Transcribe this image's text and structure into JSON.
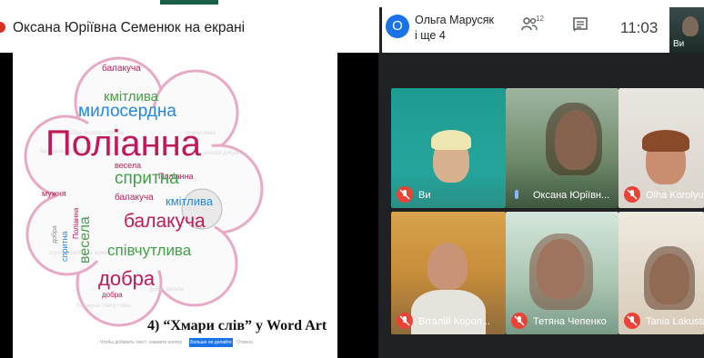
{
  "presentation": {
    "title": "Оксана Юріївна Семенюк на екрані",
    "slide": {
      "caption": "4) “Хмари слів” у Word Art",
      "footer_left": "Чтобы добавить текст, нажмите кнопку",
      "footer_button": "Больше не делайте",
      "footer_right": "Отмена",
      "words": [
        {
          "text": "Поліанна",
          "id": "w1"
        },
        {
          "text": "кмітлива",
          "id": "w2"
        },
        {
          "text": "милосердна",
          "id": "w3"
        },
        {
          "text": "балакуча",
          "id": "w4"
        },
        {
          "text": "спритна",
          "id": "w5"
        },
        {
          "text": "весела",
          "id": "w6"
        },
        {
          "text": "Поліанна",
          "id": "w7"
        },
        {
          "text": "мужня",
          "id": "w8"
        },
        {
          "text": "кмітлива",
          "id": "w9"
        },
        {
          "text": "балакуча",
          "id": "w10"
        },
        {
          "text": "весела",
          "id": "w11"
        },
        {
          "text": "співчутлива",
          "id": "w12"
        },
        {
          "text": "добра",
          "id": "w13"
        },
        {
          "text": "Поліанна",
          "id": "w14"
        },
        {
          "text": "мужня",
          "id": "w15"
        },
        {
          "text": "балакуча",
          "id": "w16"
        },
        {
          "text": "добра",
          "id": "w17"
        },
        {
          "text": "спритна",
          "id": "w18"
        }
      ]
    }
  },
  "header": {
    "user_chip_initial": "О",
    "user_chip_line1": "Ольга Марусяк",
    "user_chip_line2": "і ще 4",
    "people_count": "12",
    "time": "11:03",
    "self_label": "Ви"
  },
  "participants": [
    {
      "name": "Ви",
      "muted": true
    },
    {
      "name": "Оксана Юріївн...",
      "muted": false
    },
    {
      "name": "Olha Korolyuk",
      "muted": true
    },
    {
      "name": "Віталій Корол...",
      "muted": true
    },
    {
      "name": "Тетяна Чепенко",
      "muted": true
    },
    {
      "name": "Tania Lakusta",
      "muted": true
    }
  ],
  "colors": {
    "accent_blue": "#1a73e8",
    "mute_red": "#ea4335",
    "present_red": "#d93025",
    "cloud_pink": "#c2185b",
    "cloud_green": "#43a047",
    "cloud_blue": "#1e88e5"
  },
  "icons": {
    "people": "people-icon",
    "chat": "chat-icon",
    "mic_off": "mic-off-icon"
  }
}
